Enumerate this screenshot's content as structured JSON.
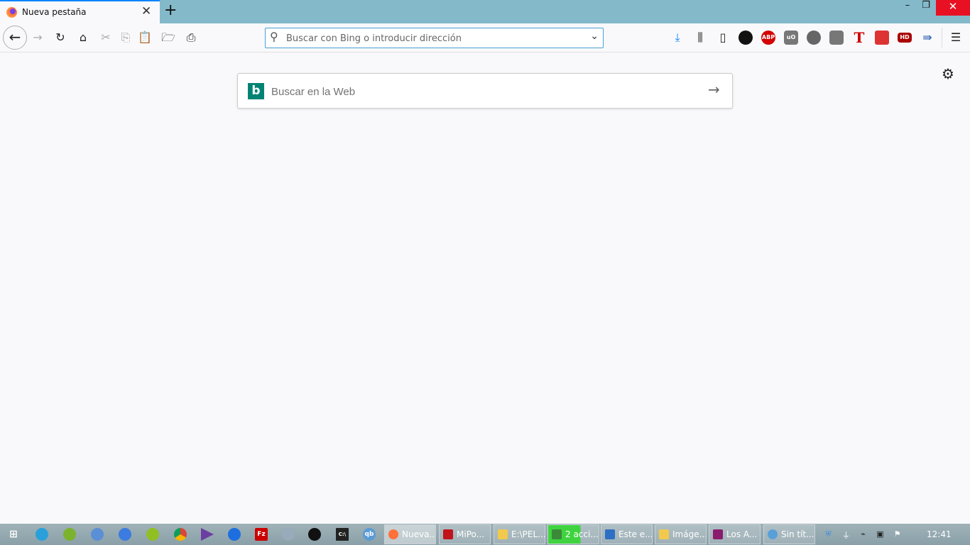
{
  "tab": {
    "title": "Nueva pestaña",
    "close": "✕",
    "new": "+"
  },
  "window": {
    "minimize": "–",
    "restore": "❐",
    "close": "✕"
  },
  "urlbar": {
    "placeholder": "Buscar con Bing o introducir dirección"
  },
  "search": {
    "placeholder": "Buscar en la Web",
    "logo": "b"
  },
  "extensions": {
    "abp": "ABP",
    "ublock": "uO",
    "tiktok": "T",
    "hd": "HD"
  },
  "taskbar": {
    "tasks": [
      {
        "label": "Nueva...",
        "color": "#ff7139"
      },
      {
        "label": "MiPo...",
        "color": "#c0131c"
      },
      {
        "label": "E:\\PEL...",
        "color": "#f2c94c"
      },
      {
        "label": "2 acci...",
        "color": "#3a8a3a"
      },
      {
        "label": "Este e...",
        "color": "#2d6fc4"
      },
      {
        "label": "Imáge...",
        "color": "#f2c94c"
      },
      {
        "label": "Los A...",
        "color": "#8b1b6e"
      },
      {
        "label": "Sin tít...",
        "color": "#5aa0d8"
      }
    ],
    "clock": "12:41"
  }
}
